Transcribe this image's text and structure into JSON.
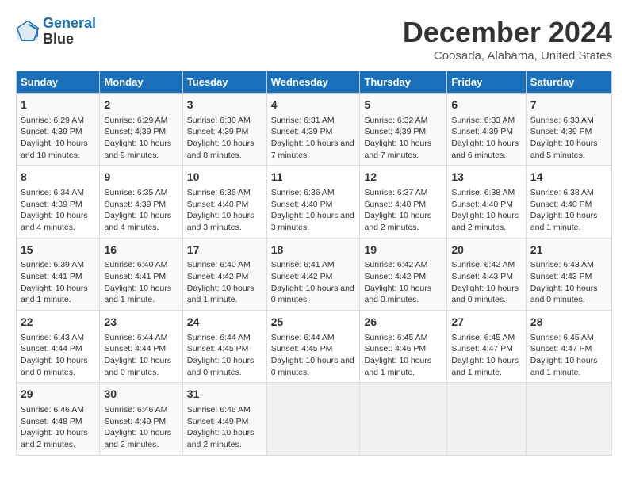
{
  "logo": {
    "line1": "General",
    "line2": "Blue"
  },
  "title": "December 2024",
  "subtitle": "Coosada, Alabama, United States",
  "days_header": [
    "Sunday",
    "Monday",
    "Tuesday",
    "Wednesday",
    "Thursday",
    "Friday",
    "Saturday"
  ],
  "weeks": [
    [
      {
        "day": "1",
        "sunrise": "Sunrise: 6:29 AM",
        "sunset": "Sunset: 4:39 PM",
        "daylight": "Daylight: 10 hours and 10 minutes."
      },
      {
        "day": "2",
        "sunrise": "Sunrise: 6:29 AM",
        "sunset": "Sunset: 4:39 PM",
        "daylight": "Daylight: 10 hours and 9 minutes."
      },
      {
        "day": "3",
        "sunrise": "Sunrise: 6:30 AM",
        "sunset": "Sunset: 4:39 PM",
        "daylight": "Daylight: 10 hours and 8 minutes."
      },
      {
        "day": "4",
        "sunrise": "Sunrise: 6:31 AM",
        "sunset": "Sunset: 4:39 PM",
        "daylight": "Daylight: 10 hours and 7 minutes."
      },
      {
        "day": "5",
        "sunrise": "Sunrise: 6:32 AM",
        "sunset": "Sunset: 4:39 PM",
        "daylight": "Daylight: 10 hours and 7 minutes."
      },
      {
        "day": "6",
        "sunrise": "Sunrise: 6:33 AM",
        "sunset": "Sunset: 4:39 PM",
        "daylight": "Daylight: 10 hours and 6 minutes."
      },
      {
        "day": "7",
        "sunrise": "Sunrise: 6:33 AM",
        "sunset": "Sunset: 4:39 PM",
        "daylight": "Daylight: 10 hours and 5 minutes."
      }
    ],
    [
      {
        "day": "8",
        "sunrise": "Sunrise: 6:34 AM",
        "sunset": "Sunset: 4:39 PM",
        "daylight": "Daylight: 10 hours and 4 minutes."
      },
      {
        "day": "9",
        "sunrise": "Sunrise: 6:35 AM",
        "sunset": "Sunset: 4:39 PM",
        "daylight": "Daylight: 10 hours and 4 minutes."
      },
      {
        "day": "10",
        "sunrise": "Sunrise: 6:36 AM",
        "sunset": "Sunset: 4:40 PM",
        "daylight": "Daylight: 10 hours and 3 minutes."
      },
      {
        "day": "11",
        "sunrise": "Sunrise: 6:36 AM",
        "sunset": "Sunset: 4:40 PM",
        "daylight": "Daylight: 10 hours and 3 minutes."
      },
      {
        "day": "12",
        "sunrise": "Sunrise: 6:37 AM",
        "sunset": "Sunset: 4:40 PM",
        "daylight": "Daylight: 10 hours and 2 minutes."
      },
      {
        "day": "13",
        "sunrise": "Sunrise: 6:38 AM",
        "sunset": "Sunset: 4:40 PM",
        "daylight": "Daylight: 10 hours and 2 minutes."
      },
      {
        "day": "14",
        "sunrise": "Sunrise: 6:38 AM",
        "sunset": "Sunset: 4:40 PM",
        "daylight": "Daylight: 10 hours and 1 minute."
      }
    ],
    [
      {
        "day": "15",
        "sunrise": "Sunrise: 6:39 AM",
        "sunset": "Sunset: 4:41 PM",
        "daylight": "Daylight: 10 hours and 1 minute."
      },
      {
        "day": "16",
        "sunrise": "Sunrise: 6:40 AM",
        "sunset": "Sunset: 4:41 PM",
        "daylight": "Daylight: 10 hours and 1 minute."
      },
      {
        "day": "17",
        "sunrise": "Sunrise: 6:40 AM",
        "sunset": "Sunset: 4:42 PM",
        "daylight": "Daylight: 10 hours and 1 minute."
      },
      {
        "day": "18",
        "sunrise": "Sunrise: 6:41 AM",
        "sunset": "Sunset: 4:42 PM",
        "daylight": "Daylight: 10 hours and 0 minutes."
      },
      {
        "day": "19",
        "sunrise": "Sunrise: 6:42 AM",
        "sunset": "Sunset: 4:42 PM",
        "daylight": "Daylight: 10 hours and 0 minutes."
      },
      {
        "day": "20",
        "sunrise": "Sunrise: 6:42 AM",
        "sunset": "Sunset: 4:43 PM",
        "daylight": "Daylight: 10 hours and 0 minutes."
      },
      {
        "day": "21",
        "sunrise": "Sunrise: 6:43 AM",
        "sunset": "Sunset: 4:43 PM",
        "daylight": "Daylight: 10 hours and 0 minutes."
      }
    ],
    [
      {
        "day": "22",
        "sunrise": "Sunrise: 6:43 AM",
        "sunset": "Sunset: 4:44 PM",
        "daylight": "Daylight: 10 hours and 0 minutes."
      },
      {
        "day": "23",
        "sunrise": "Sunrise: 6:44 AM",
        "sunset": "Sunset: 4:44 PM",
        "daylight": "Daylight: 10 hours and 0 minutes."
      },
      {
        "day": "24",
        "sunrise": "Sunrise: 6:44 AM",
        "sunset": "Sunset: 4:45 PM",
        "daylight": "Daylight: 10 hours and 0 minutes."
      },
      {
        "day": "25",
        "sunrise": "Sunrise: 6:44 AM",
        "sunset": "Sunset: 4:45 PM",
        "daylight": "Daylight: 10 hours and 0 minutes."
      },
      {
        "day": "26",
        "sunrise": "Sunrise: 6:45 AM",
        "sunset": "Sunset: 4:46 PM",
        "daylight": "Daylight: 10 hours and 1 minute."
      },
      {
        "day": "27",
        "sunrise": "Sunrise: 6:45 AM",
        "sunset": "Sunset: 4:47 PM",
        "daylight": "Daylight: 10 hours and 1 minute."
      },
      {
        "day": "28",
        "sunrise": "Sunrise: 6:45 AM",
        "sunset": "Sunset: 4:47 PM",
        "daylight": "Daylight: 10 hours and 1 minute."
      }
    ],
    [
      {
        "day": "29",
        "sunrise": "Sunrise: 6:46 AM",
        "sunset": "Sunset: 4:48 PM",
        "daylight": "Daylight: 10 hours and 2 minutes."
      },
      {
        "day": "30",
        "sunrise": "Sunrise: 6:46 AM",
        "sunset": "Sunset: 4:49 PM",
        "daylight": "Daylight: 10 hours and 2 minutes."
      },
      {
        "day": "31",
        "sunrise": "Sunrise: 6:46 AM",
        "sunset": "Sunset: 4:49 PM",
        "daylight": "Daylight: 10 hours and 2 minutes."
      },
      null,
      null,
      null,
      null
    ]
  ]
}
